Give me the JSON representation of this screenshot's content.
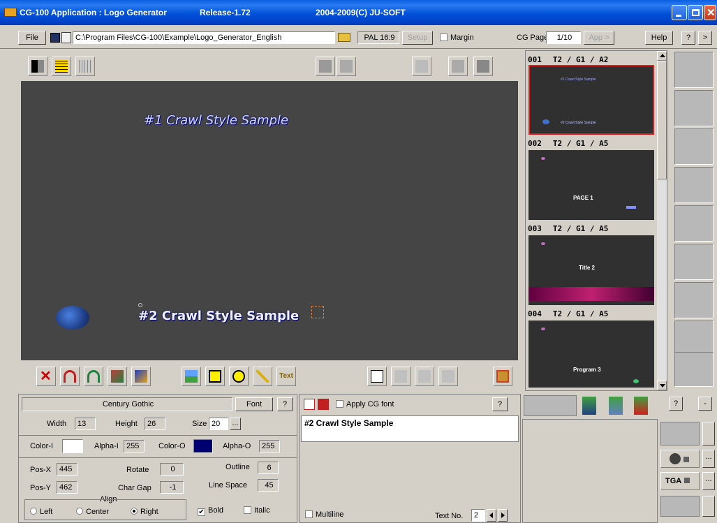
{
  "titlebar": {
    "app_title": "CG-100 Application : Logo Generator",
    "release": "Release-1.72",
    "copyright": "2004-2009(C) JU-SOFT"
  },
  "toolbar": {
    "file_label": "File",
    "path": "C:\\Program Files\\CG-100\\Example\\Logo_Generator_English",
    "format": "PAL 16:9",
    "setup_label": "Setup",
    "margin_label": "Margin",
    "cg_page_label": "CG Page",
    "cg_page_value": "1/10",
    "app_label": "App >",
    "help_label": "Help",
    "question_label": "?",
    "next_label": ">"
  },
  "canvas": {
    "text1": "#1 Crawl Style Sample",
    "text2": "#2 Crawl Style Sample"
  },
  "pages": [
    {
      "num": "001",
      "info": "T2 / G1 / A2",
      "line1": "#1 Crawl Style Sample",
      "line2": "#2 Crawl Style Sample"
    },
    {
      "num": "002",
      "info": "T2 / G1 / A5",
      "caption": "PAGE 1"
    },
    {
      "num": "003",
      "info": "T2 / G1 / A5",
      "caption": "Title 2"
    },
    {
      "num": "004",
      "info": "T2 / G1 / A5",
      "caption": "Program 3"
    }
  ],
  "bottom_tools": {
    "text_tool": "Text"
  },
  "props": {
    "font_name": "Century Gothic",
    "font_button": "Font",
    "help": "?",
    "width_label": "Width",
    "width_value": "13",
    "height_label": "Height",
    "height_value": "26",
    "size_label": "Size",
    "size_value": "20",
    "ellipsis": "...",
    "color_i_label": "Color-I",
    "alpha_i_label": "Alpha-I",
    "alpha_i_value": "255",
    "color_o_label": "Color-O",
    "alpha_o_label": "Alpha-O",
    "alpha_o_value": "255",
    "color_i": "#ffffff",
    "color_o": "#000070",
    "posx_label": "Pos-X",
    "posx_value": "445",
    "rotate_label": "Rotate",
    "rotate_value": "0",
    "outline_label": "Outline",
    "outline_value": "6",
    "posy_label": "Pos-Y",
    "posy_value": "462",
    "chargap_label": "Char Gap",
    "chargap_value": "-1",
    "linespace_label": "Line Space",
    "linespace_value": "45",
    "align_label": "Align",
    "align_left": "Left",
    "align_center": "Center",
    "align_right": "Right",
    "bold_label": "Bold",
    "italic_label": "Italic"
  },
  "text_panel": {
    "apply_cg_font": "Apply CG font",
    "help": "?",
    "content": "#2 Crawl Style Sample",
    "multiline": "Multiline",
    "text_no_label": "Text No.",
    "text_no_value": "2"
  },
  "right_panel": {
    "help": "?",
    "minus": "-",
    "tga": "TGA",
    "ellipsis": "..."
  }
}
